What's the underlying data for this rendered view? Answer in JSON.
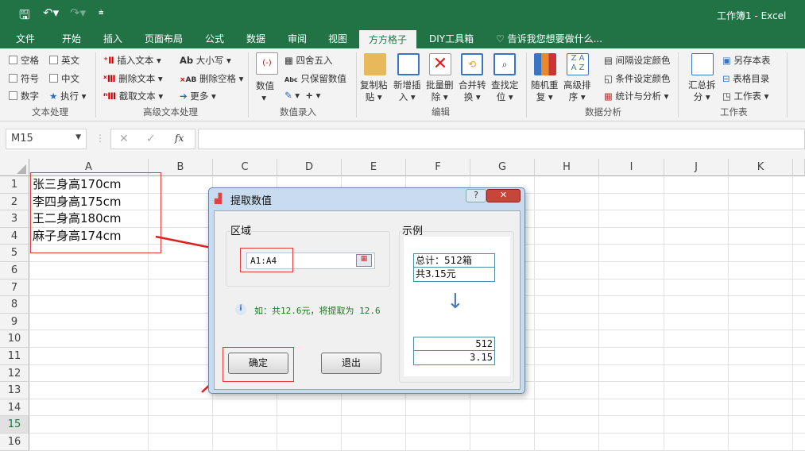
{
  "window": {
    "title": "工作簿1 - Excel"
  },
  "tabs": [
    "文件",
    "开始",
    "插入",
    "页面布局",
    "公式",
    "数据",
    "审阅",
    "视图",
    "方方格子",
    "DIY工具箱"
  ],
  "tell_me": "告诉我您想要做什么...",
  "ribbon": {
    "text_group": {
      "label": "文本处理",
      "checks": [
        "空格",
        "英文",
        "符号",
        "中文",
        "数字"
      ],
      "run": "执行"
    },
    "adv_group": {
      "label": "高级文本处理",
      "items": [
        "插入文本",
        "删除文本",
        "截取文本",
        "大小写",
        "删除空格",
        "更多"
      ]
    },
    "num_group": {
      "label": "数值录入",
      "big": "数值",
      "items": [
        "四舍五入",
        "只保留数值"
      ]
    },
    "edit_group": {
      "label": "编辑",
      "buttons": [
        [
          "复制粘",
          "贴"
        ],
        [
          "新增插",
          "入"
        ],
        [
          "批量删",
          "除"
        ],
        [
          "合并转",
          "换"
        ],
        [
          "查找定",
          "位"
        ]
      ]
    },
    "analysis_group": {
      "label": "数据分析",
      "buttons": [
        [
          "随机重",
          "复"
        ],
        [
          "高级排",
          "序"
        ]
      ],
      "items": [
        "间隔设定颜色",
        "条件设定颜色",
        "统计与分析"
      ]
    },
    "sheet_group": {
      "label": "工作表",
      "big": [
        "汇总拆",
        "分"
      ],
      "items": [
        "另存本表",
        "表格目录",
        "工作表"
      ]
    }
  },
  "formula_bar": {
    "name_box": "M15",
    "fx": "fx",
    "value": ""
  },
  "columns": [
    "A",
    "B",
    "C",
    "D",
    "E",
    "F",
    "G",
    "H",
    "I",
    "J",
    "K"
  ],
  "rows": [
    "1",
    "2",
    "3",
    "4",
    "5",
    "6",
    "7",
    "8",
    "9",
    "10",
    "11",
    "12",
    "13",
    "14",
    "15",
    "16"
  ],
  "cells": [
    "张三身高170cm",
    "李四身高175cm",
    "王二身高180cm",
    "麻子身高174cm"
  ],
  "dialog": {
    "title": "提取数值",
    "help": "?",
    "close": "✕",
    "area_label": "区域",
    "range_value": "A1:A4",
    "example_label": "示例",
    "example_before": [
      "总计：512箱",
      "共3.15元"
    ],
    "example_after": [
      "512",
      "3.15"
    ],
    "hint": "如：共12.6元，将提取为 12.6",
    "ok": "确定",
    "exit": "退出"
  }
}
